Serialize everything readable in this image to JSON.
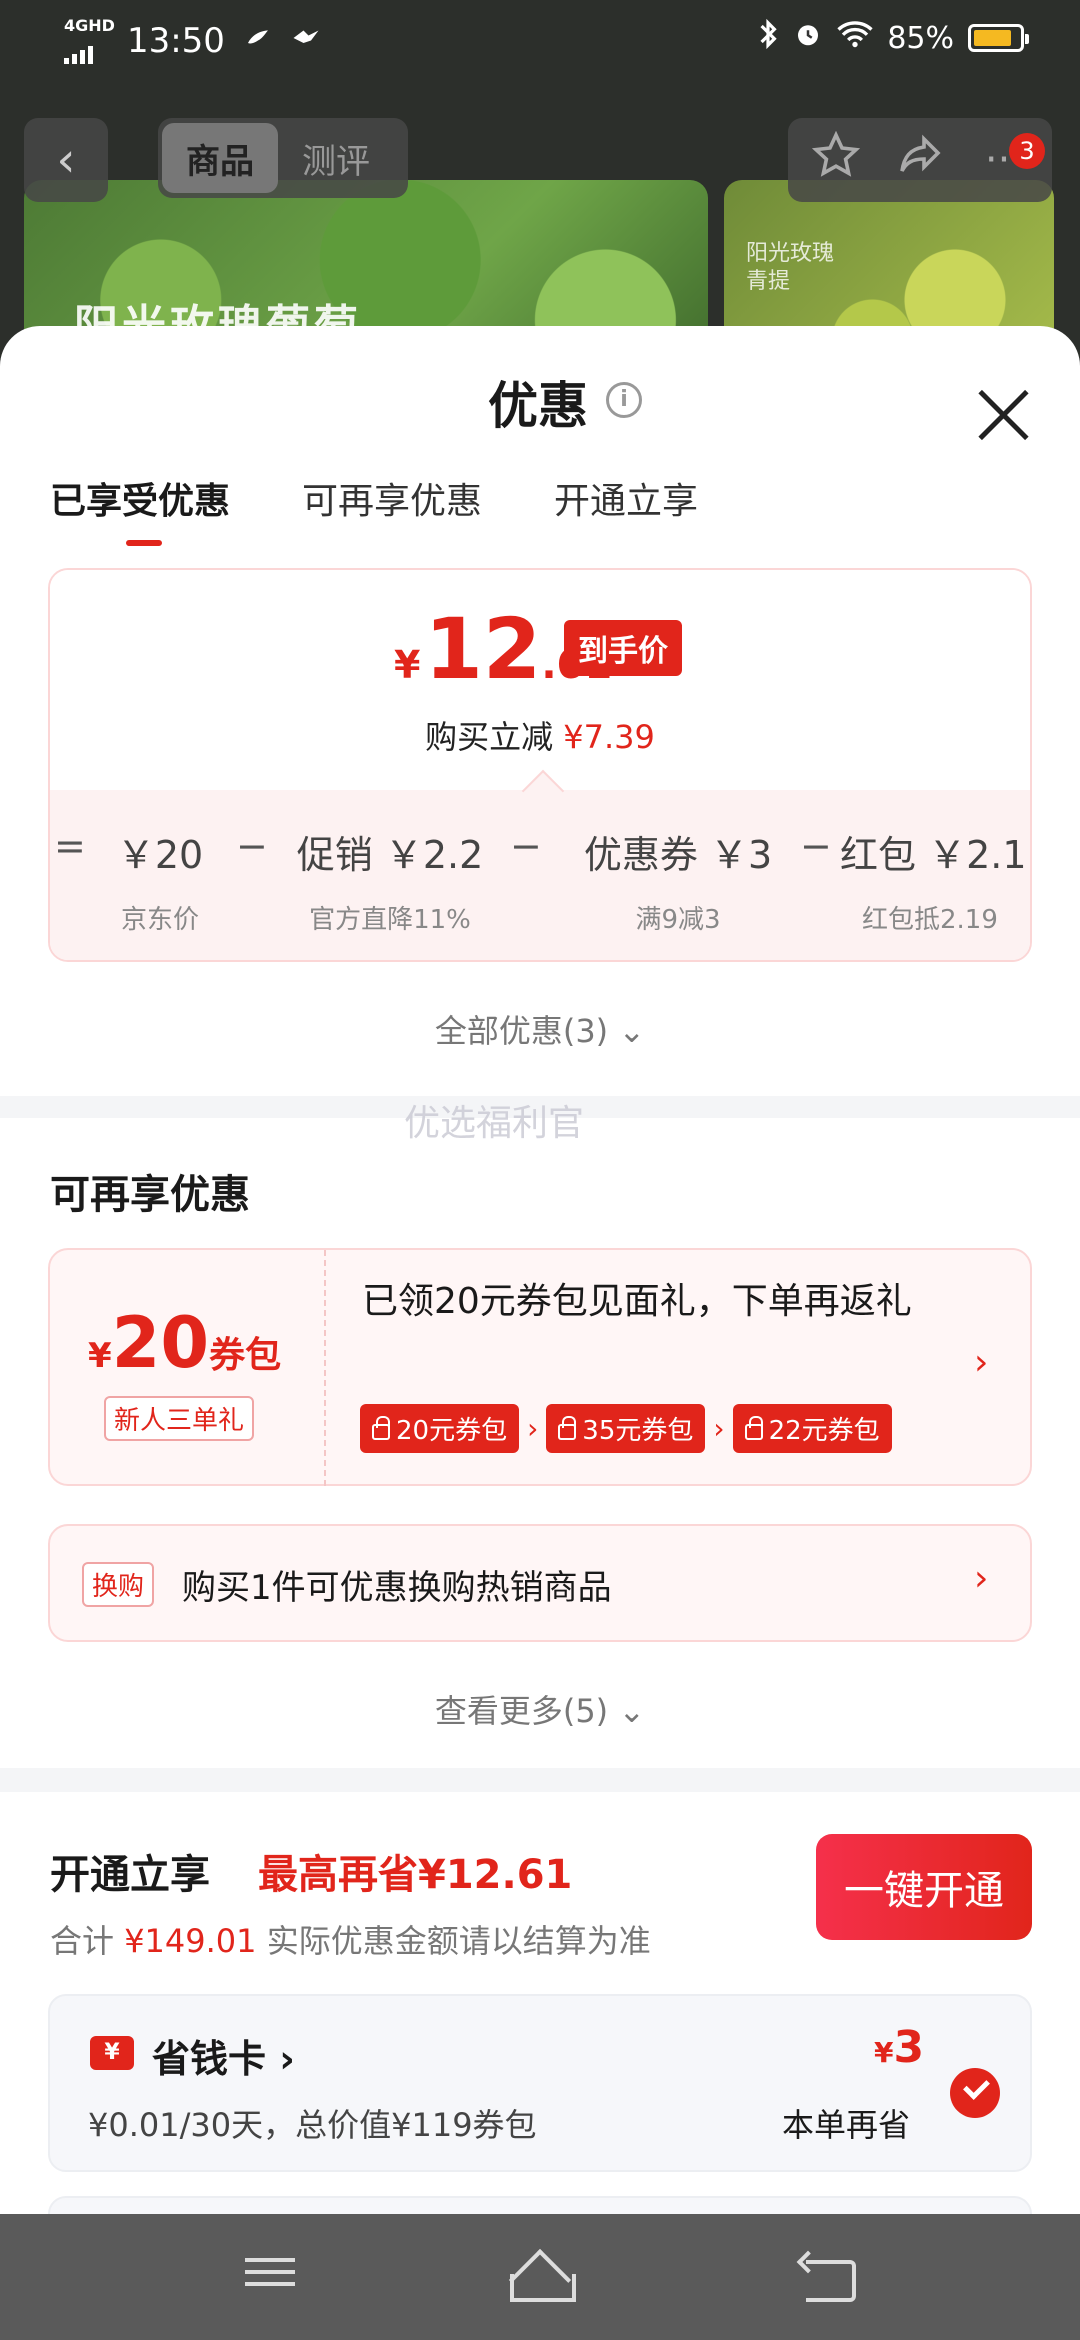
{
  "status_bar": {
    "network": "4GHD",
    "time": "13:50",
    "battery": "85%",
    "battery_level": 0.85
  },
  "background": {
    "back_glyph": "‹",
    "tabs": [
      "商品",
      "测评"
    ],
    "banner_text": "阳光玫瑰葡萄",
    "side_banner_text": "阳光玫瑰\n青提",
    "actions": [
      "star-icon",
      "share-icon",
      "more-icon"
    ],
    "more_glyph": "···",
    "badge": "3"
  },
  "sheet": {
    "title": "优惠",
    "info_glyph": "i",
    "tabs": [
      "已享受优惠",
      "可再享优惠",
      "开通立享"
    ],
    "price": {
      "currency": "¥",
      "integer": "12",
      "decimal": ".61",
      "tag": "到手价",
      "reduce_label": "购买立减",
      "reduce_value": "¥7.39"
    },
    "formula": {
      "ops": [
        "=",
        "−",
        "−",
        "−"
      ],
      "terms": [
        {
          "value": "￥20",
          "sub": "京东价"
        },
        {
          "value": "促销 ￥2.2",
          "sub": "官方直降11%"
        },
        {
          "value": "优惠券 ￥3",
          "sub": "满9减3"
        },
        {
          "value": "红包 ￥2.1",
          "sub": "红包抵2.19"
        }
      ]
    },
    "all_offers": "全部优惠(3)",
    "chevron_down": "⌄",
    "ghost": "优选福利官",
    "more_section_title": "可再享优惠",
    "coupon": {
      "currency": "¥",
      "amount": "20",
      "unit": "券包",
      "subtitle": "新人三单礼",
      "text": "已领20元券包见面礼，下单再返礼",
      "chips": [
        "20元券包",
        "35元券包",
        "22元券包"
      ],
      "chip_arrow": "›",
      "chevron": "›"
    },
    "swap": {
      "tag": "换购",
      "text": "购买1件可优惠换购热销商品",
      "chevron": "›"
    },
    "see_more": "查看更多(5)",
    "open": {
      "title": "开通立享",
      "max_save": "最高再省¥12.61",
      "sub_prefix": "合计",
      "sub_total": "¥149.01",
      "sub_suffix": "实际优惠金额请以结算为准",
      "button": "一键开通"
    },
    "card": {
      "icon_glyph": "¥",
      "name": "省钱卡 ›",
      "desc": "¥0.01/30天，总价值¥119券包",
      "save_currency": "¥",
      "save_amount": "3",
      "save_label": "本单再省"
    }
  },
  "colors": {
    "accent": "#e1251b",
    "card_tint": "#fff6f6",
    "nav_bar": "#5a5a5a"
  }
}
